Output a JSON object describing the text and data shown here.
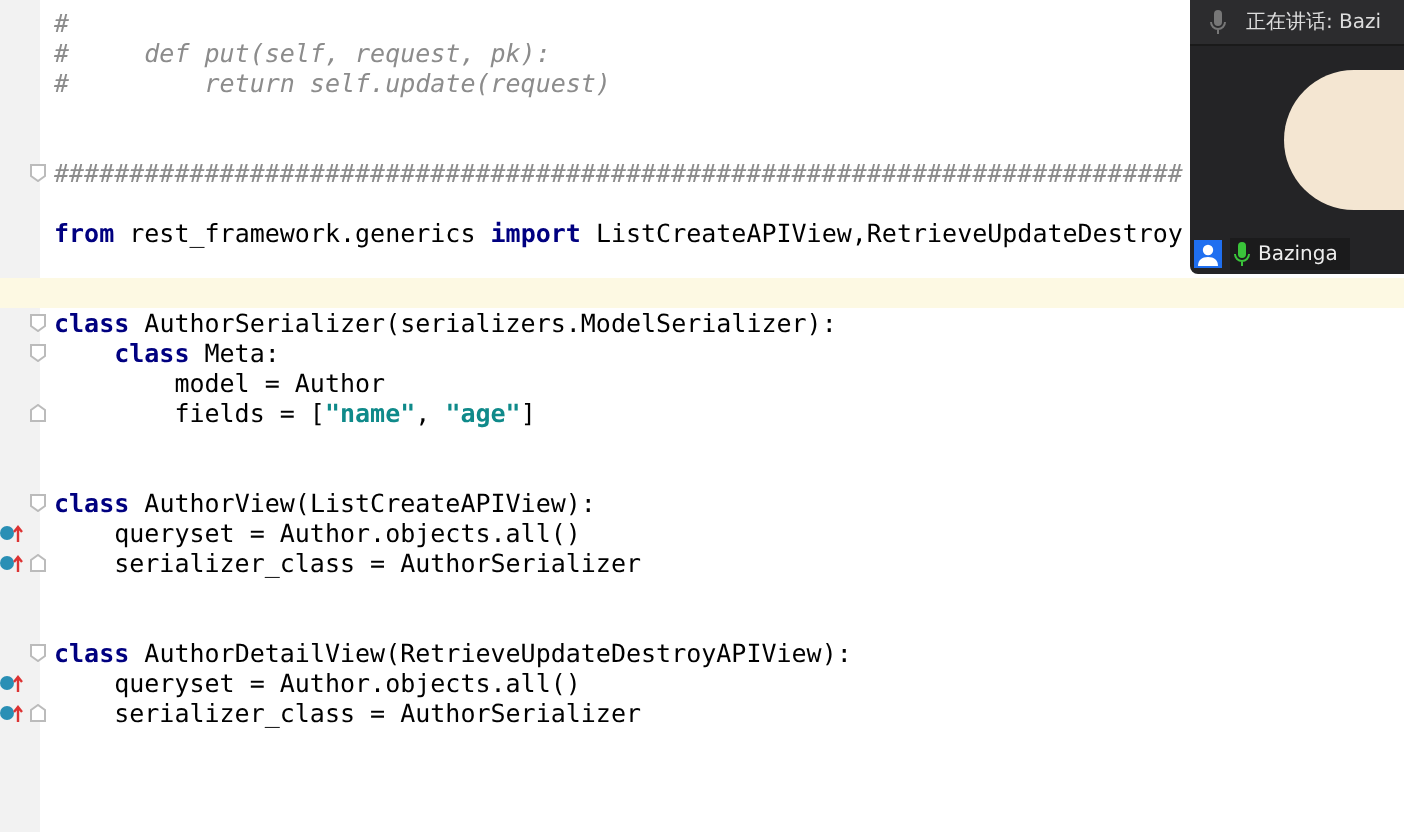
{
  "editor": {
    "lines": [
      {
        "current": false,
        "overridden": false,
        "fold_start": false,
        "fold_end": false,
        "segments": [
          {
            "kind": "comment",
            "text": "#"
          }
        ]
      },
      {
        "current": false,
        "overridden": false,
        "fold_start": false,
        "fold_end": false,
        "segments": [
          {
            "kind": "comment",
            "text": "#     def put(self, request, pk):"
          }
        ]
      },
      {
        "current": false,
        "overridden": false,
        "fold_start": false,
        "fold_end": false,
        "segments": [
          {
            "kind": "comment",
            "text": "#         return self.update(request)"
          }
        ]
      },
      {
        "current": false,
        "overridden": false,
        "fold_start": false,
        "fold_end": false
      },
      {
        "current": false,
        "overridden": false,
        "fold_start": false,
        "fold_end": false
      },
      {
        "current": false,
        "overridden": false,
        "fold_start": true,
        "fold_end": false,
        "segments": [
          {
            "kind": "comment",
            "text": "###########################################################################"
          }
        ]
      },
      {
        "current": false,
        "overridden": false,
        "fold_start": false,
        "fold_end": false
      },
      {
        "current": false,
        "overridden": false,
        "fold_start": false,
        "fold_end": false,
        "segments": [
          {
            "kind": "keyword",
            "text": "from"
          },
          {
            "kind": "plain",
            "text": " rest_framework.generics "
          },
          {
            "kind": "keyword",
            "text": "import"
          },
          {
            "kind": "plain",
            "text": " ListCreateAPIView,RetrieveUpdateDestroy"
          }
        ]
      },
      {
        "current": false,
        "overridden": false,
        "fold_start": false,
        "fold_end": false
      },
      {
        "current": true,
        "overridden": false,
        "fold_start": false,
        "fold_end": false
      },
      {
        "current": false,
        "overridden": false,
        "fold_start": true,
        "fold_end": false,
        "segments": [
          {
            "kind": "keyword",
            "text": "class"
          },
          {
            "kind": "plain",
            "text": " AuthorSerializer(serializers.ModelSerializer):"
          }
        ]
      },
      {
        "current": false,
        "overridden": false,
        "fold_start": true,
        "fold_end": false,
        "segments": [
          {
            "kind": "keyword",
            "text": "    class"
          },
          {
            "kind": "plain",
            "text": " Meta:"
          }
        ]
      },
      {
        "current": false,
        "overridden": false,
        "fold_start": false,
        "fold_end": false,
        "segments": [
          {
            "kind": "plain",
            "text": "        model = Author"
          }
        ]
      },
      {
        "current": false,
        "overridden": false,
        "fold_start": false,
        "fold_end": true,
        "segments": [
          {
            "kind": "plain",
            "text": "        fields = ["
          },
          {
            "kind": "string",
            "text": "\"name\""
          },
          {
            "kind": "plain",
            "text": ", "
          },
          {
            "kind": "string",
            "text": "\"age\""
          },
          {
            "kind": "plain",
            "text": "]"
          }
        ]
      },
      {
        "current": false,
        "overridden": false,
        "fold_start": false,
        "fold_end": false
      },
      {
        "current": false,
        "overridden": false,
        "fold_start": false,
        "fold_end": false
      },
      {
        "current": false,
        "overridden": false,
        "fold_start": true,
        "fold_end": false,
        "segments": [
          {
            "kind": "keyword",
            "text": "class"
          },
          {
            "kind": "plain",
            "text": " AuthorView(ListCreateAPIView):"
          }
        ]
      },
      {
        "current": false,
        "overridden": true,
        "fold_start": false,
        "fold_end": false,
        "segments": [
          {
            "kind": "plain",
            "text": "    queryset = Author.objects.all()"
          }
        ]
      },
      {
        "current": false,
        "overridden": true,
        "fold_start": false,
        "fold_end": true,
        "segments": [
          {
            "kind": "plain",
            "text": "    serializer_class = AuthorSerializer"
          }
        ]
      },
      {
        "current": false,
        "overridden": false,
        "fold_start": false,
        "fold_end": false
      },
      {
        "current": false,
        "overridden": false,
        "fold_start": false,
        "fold_end": false
      },
      {
        "current": false,
        "overridden": false,
        "fold_start": true,
        "fold_end": false,
        "segments": [
          {
            "kind": "keyword",
            "text": "class"
          },
          {
            "kind": "plain",
            "text": " AuthorDetailView(RetrieveUpdateDestroyAPIView):"
          }
        ]
      },
      {
        "current": false,
        "overridden": true,
        "fold_start": false,
        "fold_end": false,
        "segments": [
          {
            "kind": "plain",
            "text": "    queryset = Author.objects.all()"
          }
        ]
      },
      {
        "current": false,
        "overridden": true,
        "fold_start": false,
        "fold_end": true,
        "segments": [
          {
            "kind": "plain",
            "text": "    serializer_class = AuthorSerializer"
          }
        ]
      }
    ]
  },
  "video_call": {
    "speaking_label": "正在讲话: Bazi",
    "participant_name": "Bazinga"
  }
}
